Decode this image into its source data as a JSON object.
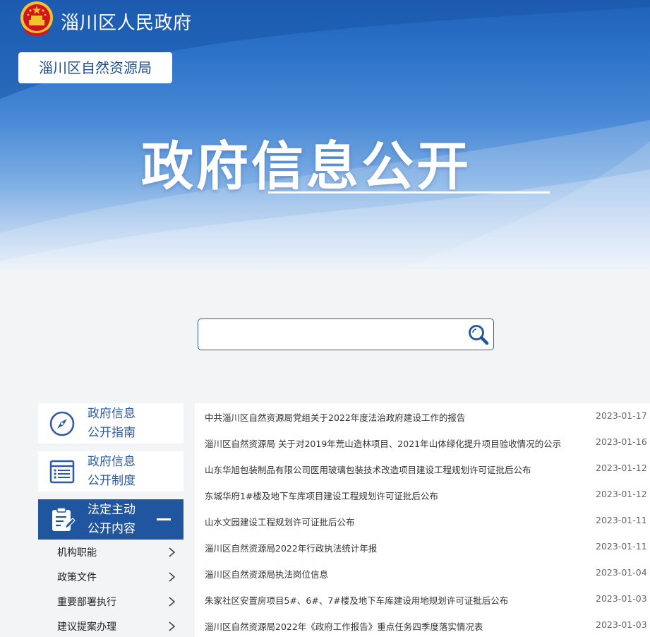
{
  "header": {
    "site_title": "淄川区人民政府",
    "department": "淄川区自然资源局",
    "hero_title": "政府信息公开"
  },
  "search": {
    "placeholder": "",
    "icon": "search-icon"
  },
  "sidebar": {
    "cards": [
      {
        "line1": "政府信息",
        "line2": "公开指南",
        "icon": "compass-icon",
        "active": false
      },
      {
        "line1": "政府信息",
        "line2": "公开制度",
        "icon": "list-document-icon",
        "active": false
      },
      {
        "line1": "法定主动",
        "line2": "公开内容",
        "icon": "clipboard-edit-icon",
        "active": true
      }
    ],
    "sub_items": [
      {
        "label": "机构职能"
      },
      {
        "label": "政策文件"
      },
      {
        "label": "重要部署执行"
      },
      {
        "label": "建议提案办理"
      }
    ]
  },
  "news": [
    {
      "title": "中共淄川区自然资源局党组关于2022年度法治政府建设工作的报告",
      "date": "2023-01-17"
    },
    {
      "title": "淄川区自然资源局 关于对2019年荒山造林项目、2021年山体绿化提升项目验收情况的公示",
      "date": "2023-01-16"
    },
    {
      "title": "山东华旭包装制品有限公司医用玻璃包装技术改造项目建设工程规划许可证批后公布",
      "date": "2023-01-12"
    },
    {
      "title": "东城华府1#楼及地下车库项目建设工程规划许可证批后公布",
      "date": "2023-01-12"
    },
    {
      "title": "山水文园建设工程规划许可证批后公布",
      "date": "2023-01-11"
    },
    {
      "title": "淄川区自然资源局2022年行政执法统计年报",
      "date": "2023-01-11"
    },
    {
      "title": "淄川区自然资源局执法岗位信息",
      "date": "2023-01-04"
    },
    {
      "title": "朱家社区安置房项目5#、6#、7#楼及地下车库建设用地规划许可证批后公布",
      "date": "2023-01-03"
    },
    {
      "title": "淄川区自然资源局2022年《政府工作报告》重点任务四季度落实情况表",
      "date": "2023-01-03"
    }
  ],
  "colors": {
    "primary_blue": "#1f569f",
    "link_blue": "#2a5aa8",
    "emblem_red": "#d2141c",
    "emblem_gold": "#f2c230"
  }
}
